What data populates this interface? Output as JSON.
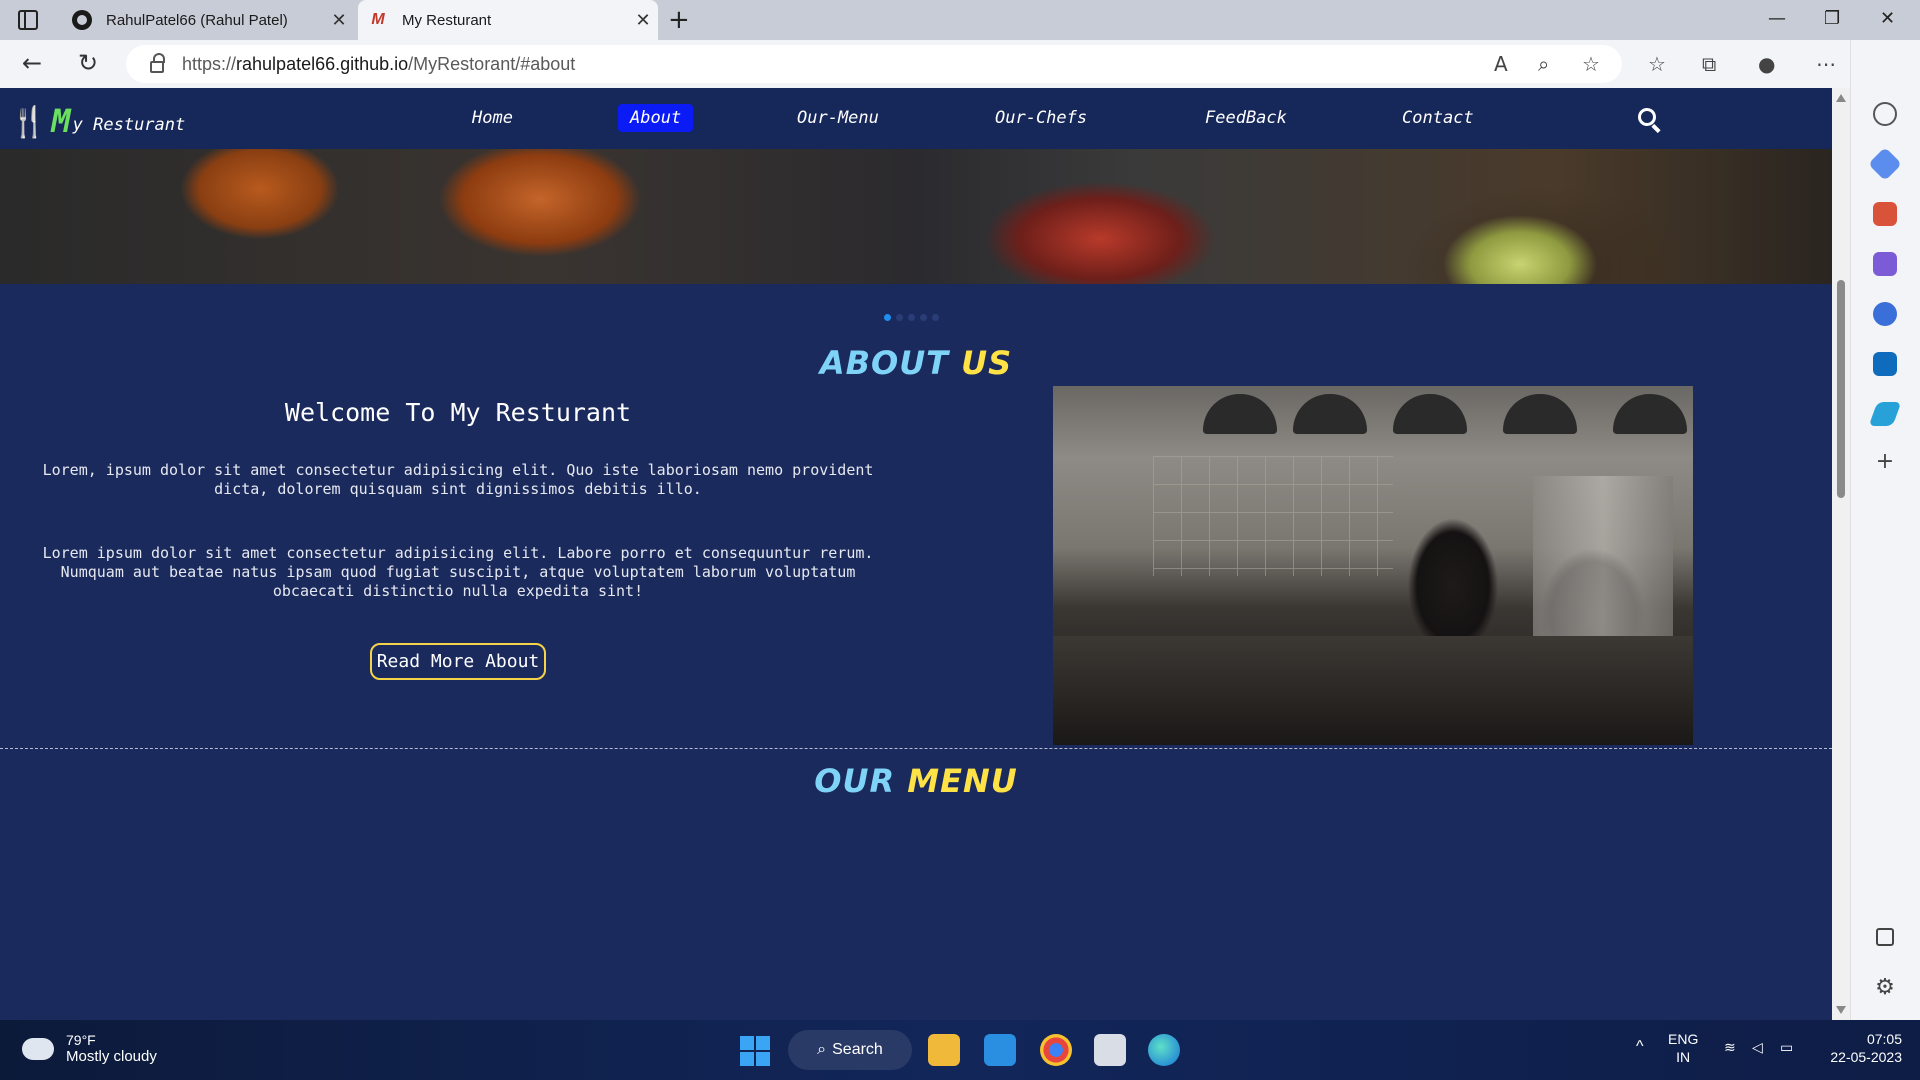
{
  "browser": {
    "tabs": [
      {
        "title": "RahulPatel66 (Rahul Patel)",
        "icon": "github-icon",
        "active": false
      },
      {
        "title": "My Resturant",
        "icon": "site-favicon-icon",
        "active": true
      }
    ],
    "url_prefix": "https://",
    "url_host": "rahulpatel66.github.io",
    "url_path": "/MyRestorant/#about",
    "window_controls": [
      "minimize",
      "restore",
      "close"
    ]
  },
  "site": {
    "brand": {
      "fork_glyph": "🍴",
      "letter": "M",
      "suffix": "y",
      "name": "Resturant",
      "fork_color": "#4fb8e0",
      "letter_color": "#6be060"
    },
    "nav": [
      "Home",
      "About",
      "Our-Menu",
      "Our-Chefs",
      "FeedBack",
      "Contact"
    ],
    "active_nav": "About",
    "carousel": {
      "slides": 5,
      "active": 1
    },
    "about": {
      "title_part1": "ABOUT",
      "title_part2": "US",
      "heading": "Welcome To My Resturant",
      "para1": "Lorem, ipsum dolor sit amet consectetur adipisicing elit. Quo iste laboriosam nemo provident dicta, dolorem quisquam sint dignissimos debitis illo.",
      "para2": "Lorem ipsum dolor sit amet consectetur adipisicing elit. Labore porro et consequuntur rerum. Numquam aut beatae natus ipsam quod fugiat suscipit, atque voluptatem laborum voluptatum obcaecati distinctio nulla expedita sint!",
      "button": "Read More About"
    },
    "menu": {
      "title_part1": "OUR",
      "title_part2": "MENU"
    },
    "colors": {
      "background": "#1a2a5c",
      "nav_bg": "#16275a",
      "active_nav": "#0b1bf5",
      "title_blue": "#7fd3f7",
      "title_yellow": "#ffe246",
      "button_border": "#f4d24a"
    }
  },
  "taskbar": {
    "weather_temp": "79°F",
    "weather_desc": "Mostly cloudy",
    "search_label": "Search",
    "lang_line1": "ENG",
    "lang_line2": "IN",
    "time": "07:05",
    "date": "22-05-2023"
  }
}
